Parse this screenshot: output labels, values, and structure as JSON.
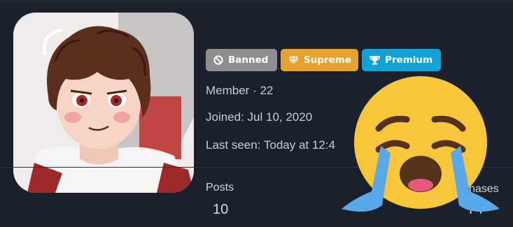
{
  "profile": {
    "badges": [
      {
        "label": "Banned",
        "icon": "ban-icon",
        "color": "#8e8e8e"
      },
      {
        "label": "Supreme",
        "icon": "diamond-icon",
        "color": "#e6a131"
      },
      {
        "label": "Premium",
        "icon": "trophy-icon",
        "color": "#11a3d5"
      }
    ],
    "member_line": "Member · 22",
    "joined": "Joined: Jul 10, 2020",
    "last_seen": "Last seen: Today at 12:4"
  },
  "stats": {
    "posts_label": "Posts",
    "posts_value": "10",
    "purchases_label": "hases",
    "purchases_value": "74"
  },
  "overlay": {
    "emoji": "loudly-crying-face-icon"
  }
}
